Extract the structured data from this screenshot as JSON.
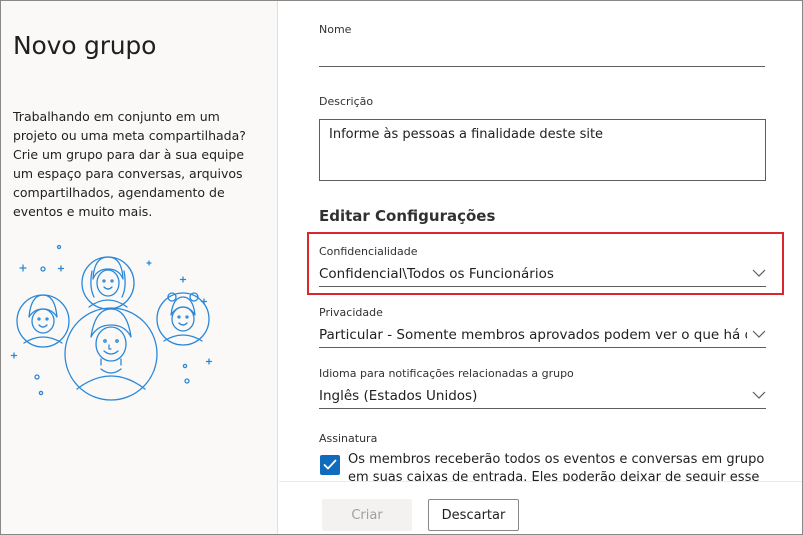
{
  "left": {
    "title": "Novo grupo",
    "description": "Trabalhando em conjunto em um projeto ou uma meta compartilhada? Crie um grupo para dar à sua equipe um espaço para conversas, arquivos compartilhados, agendamento de eventos e muito mais."
  },
  "form": {
    "name_label": "Nome",
    "name_value": "",
    "description_label": "Descrição",
    "description_value": "Informe às pessoas a finalidade deste site",
    "section_title": "Editar Configurações",
    "confidentiality": {
      "label": "Confidencialidade",
      "value": "Confidencial\\Todos os Funcionários"
    },
    "privacy": {
      "label": "Privacidade",
      "value": "Particular - Somente membros aprovados podem ver o que há dentro"
    },
    "language": {
      "label": "Idioma para notificações relacionadas a grupo",
      "value": "Inglês (Estados Unidos)"
    },
    "subscription": {
      "label": "Assinatura",
      "checked": true,
      "text": "Os membros receberão todos os eventos e conversas em grupo em suas caixas de entrada. Eles poderão deixar de seguir esse grupo mais tarde."
    }
  },
  "footer": {
    "create_label": "Criar",
    "discard_label": "Descartar"
  },
  "colors": {
    "accent": "#0f6cbd",
    "highlight": "#d9262f",
    "illustration": "#2b88d8"
  }
}
